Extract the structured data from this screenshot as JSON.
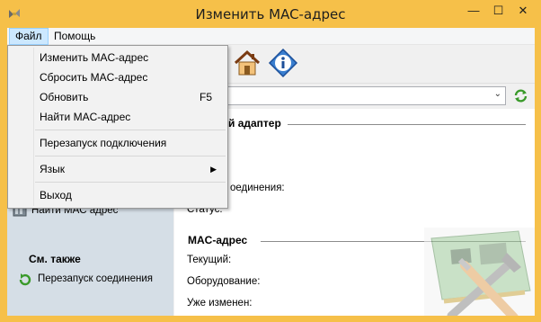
{
  "window": {
    "title": "Изменить MAC-адрес",
    "minimize": "—",
    "maximize": "☐",
    "close": "✕"
  },
  "menubar": {
    "file": "Файл",
    "help": "Помощь"
  },
  "file_menu": {
    "items": [
      {
        "label": "Изменить MAC-адрес",
        "shortcut": ""
      },
      {
        "label": "Сбросить MAC-адрес",
        "shortcut": ""
      },
      {
        "label": "Обновить",
        "shortcut": "F5"
      },
      {
        "label": "Найти MAC-адрес",
        "shortcut": ""
      },
      {
        "label": "Перезапуск подключения",
        "shortcut": ""
      },
      {
        "label": "Язык",
        "submenu_arrow": "▶"
      },
      {
        "label": "Выход",
        "shortcut": ""
      }
    ]
  },
  "sidebar": {
    "find_mac": "Найти MAC адрес",
    "see_also": "См. также",
    "restart_connection": "Перезапуск соединения"
  },
  "main": {
    "adapter_section": "й адаптер",
    "connection_label": "оединения:",
    "status_label": "Статус:",
    "mac_section": "MAC-адрес",
    "current_label": "Текущий:",
    "hardware_label": "Оборудование:",
    "changed_label": "Уже изменен:"
  },
  "combo": {
    "arrow": "⌄"
  },
  "colors": {
    "frame": "#f6c049",
    "sidebar": "#d5dee6",
    "menu_highlight": "#cce8ff",
    "menu_bg": "#f2f2f2"
  }
}
